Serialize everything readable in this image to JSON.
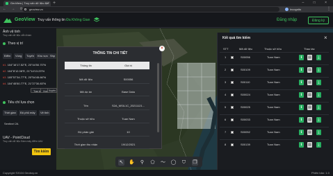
{
  "browser": {
    "tab_title": "GeoView | Truy vấn dữ liệu địa",
    "url": "geoview.vn",
    "profile_label": "Incognito"
  },
  "header": {
    "brand": "GeoView",
    "title_prefix": "Truy vấn thông tin",
    "title_accent": "Đa Không Gian",
    "login": "Đăng nhập",
    "register": "Đăng ký"
  },
  "left_panel": {
    "top_label": "Ảnh vệ tinh",
    "top_sub": "Truy vấn dữ liệu viễn thám",
    "section_region": "Theo vị trí",
    "tabs": [
      "Điểm",
      "Vùng",
      "Tuyến",
      "Khu vực",
      "Shp"
    ],
    "coords": [
      {
        "idx": "#1.",
        "text": "104°16'17.52\"E, 20°44'50.70\"N"
      },
      {
        "idx": "#2.",
        "text": "104°8'12.08\"E, 21°14'13.23\"N"
      },
      {
        "idx": "#3.",
        "text": "105°57'34.77\"E, 20°54'45.66\"N"
      },
      {
        "idx": "#4.",
        "text": "104°45'50.77\"E, 21°27'30.83\"N"
      }
    ],
    "coord_buttons": [
      "Tạo lại",
      "Xoá",
      "Xuyên"
    ],
    "section_criteria": "Tiêu chí lựa chọn",
    "criteria_tabs": [
      "Thời gian",
      "Độ phủ mây",
      "Vệ tinh"
    ],
    "sentinel": "Sentinel 2A",
    "uav_title": "UAV - PointCloud",
    "uav_sub": "Truy vấn dữ liệu Đám mây điểm UAV",
    "search_button": "Tìm kiếm"
  },
  "modal": {
    "title": "THÔNG TIN CHI TIẾT",
    "head": {
      "key": "Thông tin",
      "value": "Giá trị"
    },
    "rows": [
      {
        "key": "Mã dữ liệu",
        "value": "S00056"
      },
      {
        "key": "Mã dự án",
        "value": "Base Data"
      },
      {
        "key": "Tên",
        "value": "S2A_MSIL1C_20211121..."
      },
      {
        "key": "Thuộc sở hữu",
        "value": "Tuan Nam"
      },
      {
        "key": "Độ phân giải",
        "value": "10"
      },
      {
        "key": "Thời gian thu nhận",
        "value": "19/12/2021"
      }
    ]
  },
  "right_panel": {
    "title": "Kết quả tìm kiếm",
    "headers": {
      "stt": "STT",
      "code": "Mã dữ liệu",
      "owner": "Thuộc sở hữu",
      "actions": "Thao tác"
    },
    "rows": [
      {
        "stt": "1",
        "code": "S00056",
        "owner": "Tuan Nam"
      },
      {
        "stt": "2",
        "code": "S00109",
        "owner": "Tuan Nam"
      },
      {
        "stt": "3",
        "code": "S00110",
        "owner": "Tuan Nam"
      },
      {
        "stt": "4",
        "code": "S00024",
        "owner": "Tuan Nam"
      },
      {
        "stt": "5",
        "code": "S00025",
        "owner": "Tuan Nam"
      },
      {
        "stt": "6",
        "code": "S00033",
        "owner": "Tuan Nam"
      },
      {
        "stt": "7",
        "code": "S00052",
        "owner": "Tuan Nam"
      },
      {
        "stt": "8",
        "code": "S00139",
        "owner": "Tuan Nam"
      }
    ]
  },
  "footer": {
    "copyright": "Copyright ©2024 Geoboy.vn",
    "version": "Phiên bản: 1.0"
  },
  "colors": {
    "accent": "#3fc35e",
    "search": "#f1c40f",
    "close": "#c0392b"
  }
}
